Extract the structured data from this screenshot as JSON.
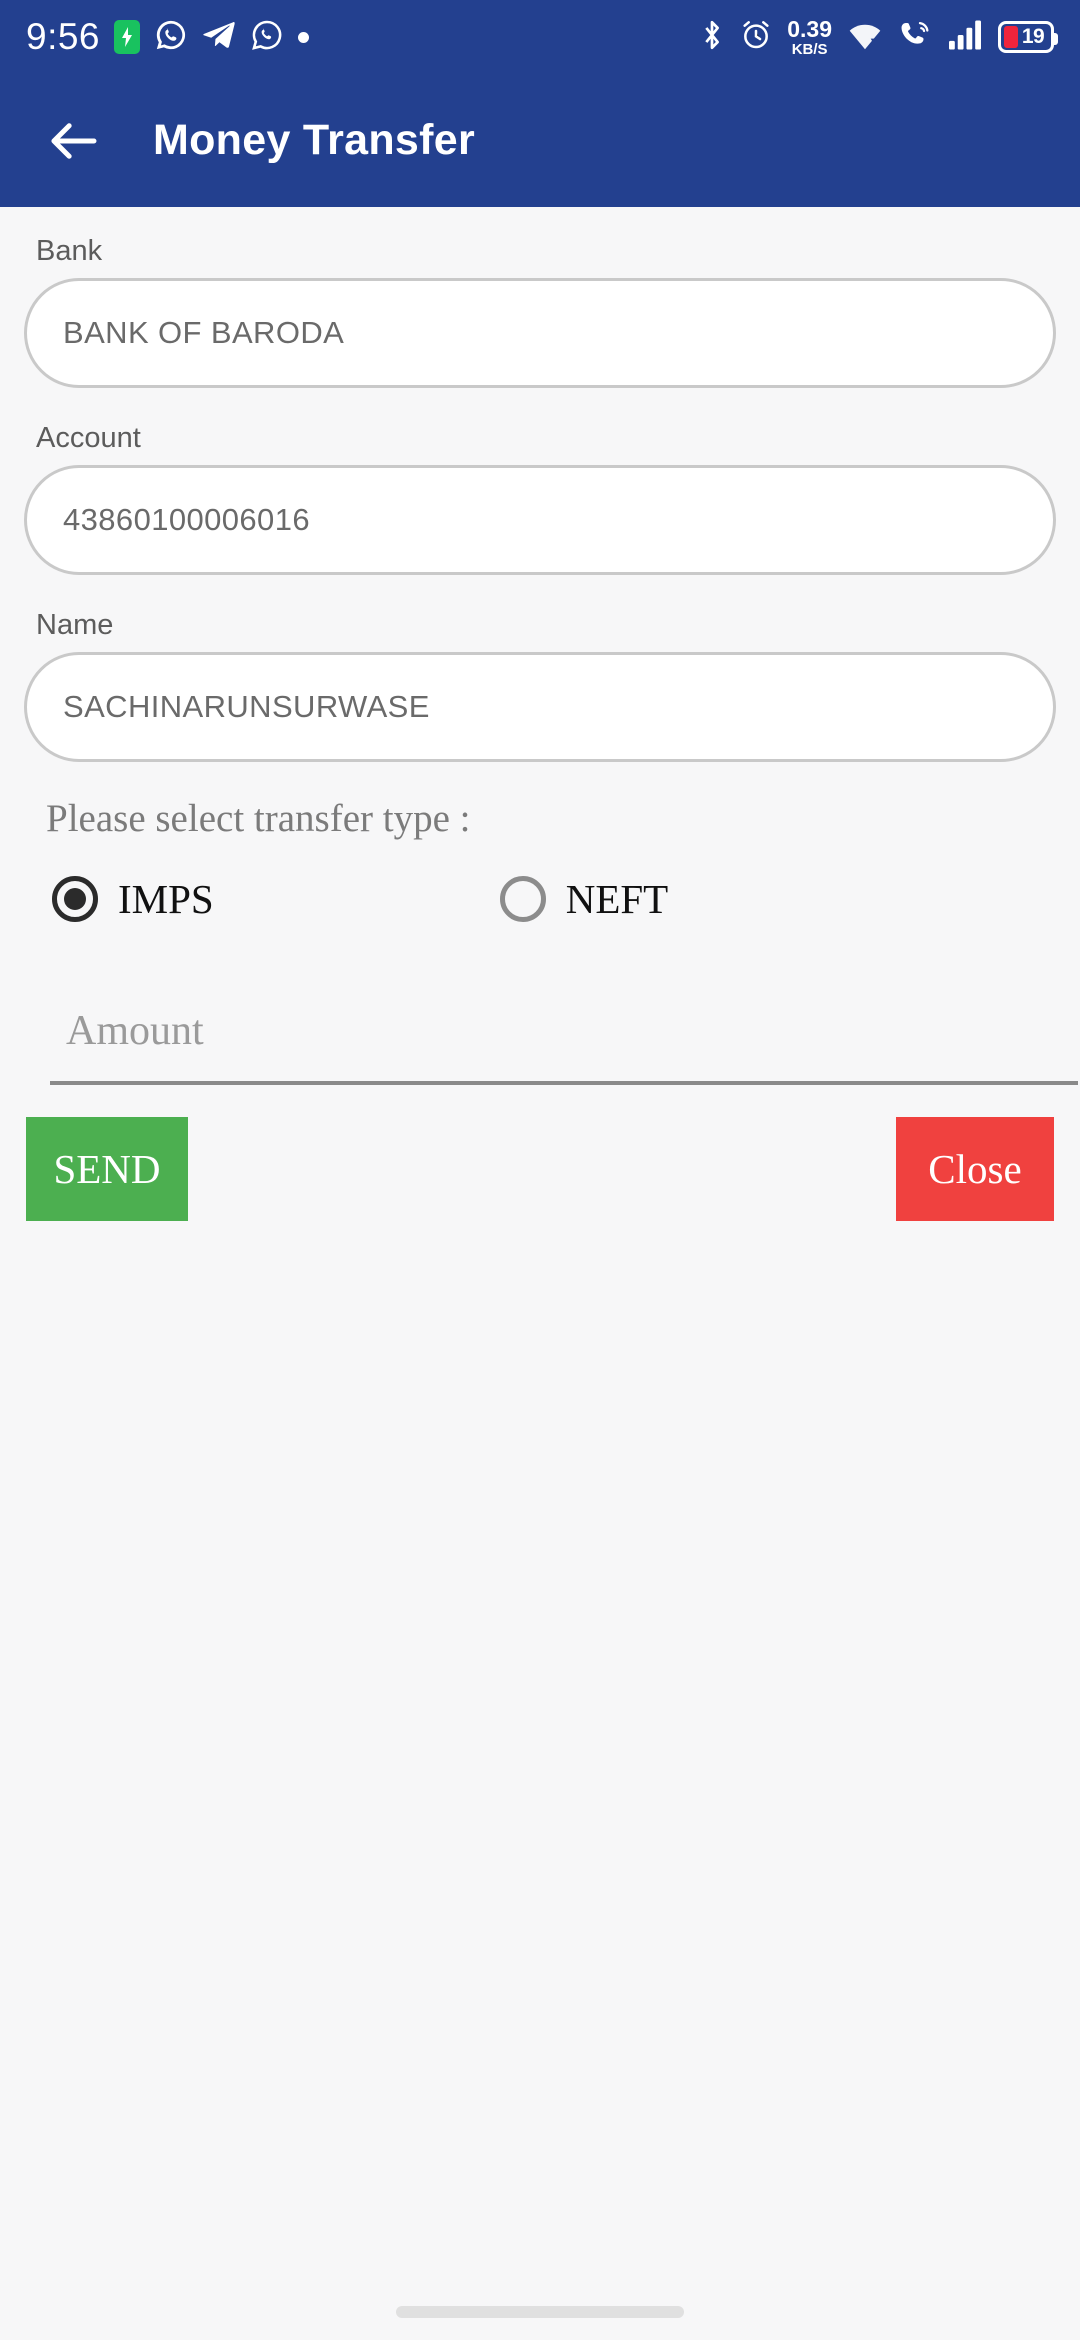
{
  "status_bar": {
    "time": "9:56",
    "network_speed_value": "0.39",
    "network_speed_unit": "KB/S",
    "battery_percent": "19",
    "icons": [
      "battery-charging-icon",
      "whatsapp-business-icon",
      "telegram-icon",
      "whatsapp-icon",
      "more-dot-icon",
      "bluetooth-icon",
      "alarm-icon",
      "network-speed-icon",
      "wifi-icon",
      "vowifi-call-icon",
      "signal-bars-icon",
      "battery-icon"
    ],
    "colors": {
      "header_blue": "#23408F",
      "battery_low_red": "#F0243C",
      "charging_green": "#19C25F"
    }
  },
  "app_bar": {
    "back_label": "back-arrow",
    "title": "Money Transfer"
  },
  "form": {
    "fields": [
      {
        "label": "Bank",
        "value": "BANK OF BARODA"
      },
      {
        "label": "Account",
        "value": "43860100006016"
      },
      {
        "label": "Name",
        "value": "SACHINARUNSURWASE"
      }
    ],
    "transfer_prompt": "Please select transfer type :",
    "transfer_types": [
      {
        "label": "IMPS",
        "selected": true
      },
      {
        "label": "NEFT",
        "selected": false
      }
    ],
    "amount": {
      "placeholder": "Amount",
      "value": ""
    }
  },
  "actions": {
    "send_label": "SEND",
    "close_label": "Close",
    "send_color": "#4CAF50",
    "close_color": "#F0413F"
  }
}
